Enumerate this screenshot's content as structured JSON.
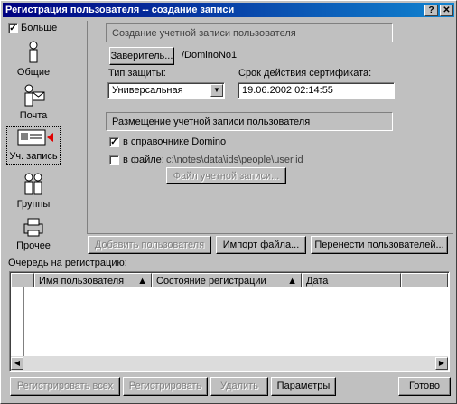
{
  "window": {
    "title": "Регистрация пользователя -- создание записи"
  },
  "more_label": "Больше",
  "sidebar": {
    "items": [
      {
        "label": "Общие"
      },
      {
        "label": "Почта"
      },
      {
        "label": "Уч. запись"
      },
      {
        "label": "Группы"
      },
      {
        "label": "Прочее"
      }
    ]
  },
  "panel": {
    "section_title": "Создание учетной записи пользователя",
    "certifier_button": "Заверитель...",
    "certifier_value": "/DominoNo1",
    "security_type_label": "Тип защиты:",
    "security_type_value": "Универсальная",
    "expiration_label": "Срок действия сертификата:",
    "expiration_value": "19.06.2002 02:14:55",
    "placement_title": "Размещение учетной записи пользователя",
    "in_directory_label": "в справочнике Domino",
    "in_file_label": "в файле:",
    "file_path": "c:\\notes\\data\\ids\\people\\user.id",
    "id_file_button": "Файл учетной записи..."
  },
  "actions": {
    "add_user": "Добавить пользователя",
    "import_file": "Импорт файла...",
    "migrate_users": "Перенести пользователей..."
  },
  "queue": {
    "label": "Очередь на регистрацию:",
    "columns": [
      "Имя пользователя",
      "Состояние регистрации",
      "Дата"
    ]
  },
  "footer": {
    "register_all": "Регистрировать всех",
    "register": "Регистрировать",
    "delete": "Удалить",
    "options": "Параметры",
    "done": "Готово"
  }
}
